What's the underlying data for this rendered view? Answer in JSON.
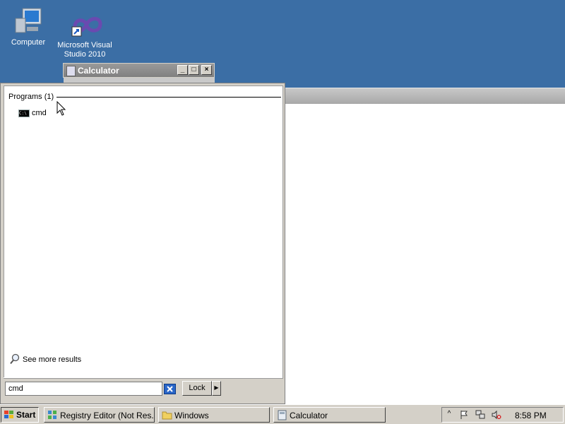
{
  "desktop": {
    "icons": [
      {
        "label_line1": "Computer",
        "label_line2": "",
        "icon": "computer-icon"
      },
      {
        "label_line1": "Microsoft Visual",
        "label_line2": "Studio 2010",
        "icon": "visual-studio-icon"
      }
    ]
  },
  "calculator_window": {
    "title": "Calculator"
  },
  "start_menu": {
    "section_header": "Programs (1)",
    "results": [
      {
        "label": "cmd",
        "icon": "cmd-icon"
      }
    ],
    "see_more": "See more results",
    "search_value": "cmd",
    "lock_label": "Lock"
  },
  "taskbar": {
    "start_label": "Start",
    "buttons": [
      {
        "label": "Registry Editor (Not Res...",
        "icon": "registry-icon"
      },
      {
        "label": "Windows",
        "icon": "folder-icon"
      },
      {
        "label": "Calculator",
        "icon": "calculator-icon"
      }
    ],
    "clock": "8:58 PM"
  },
  "colors": {
    "desktop": "#3b6ea5",
    "chrome": "#d4d0c8"
  }
}
